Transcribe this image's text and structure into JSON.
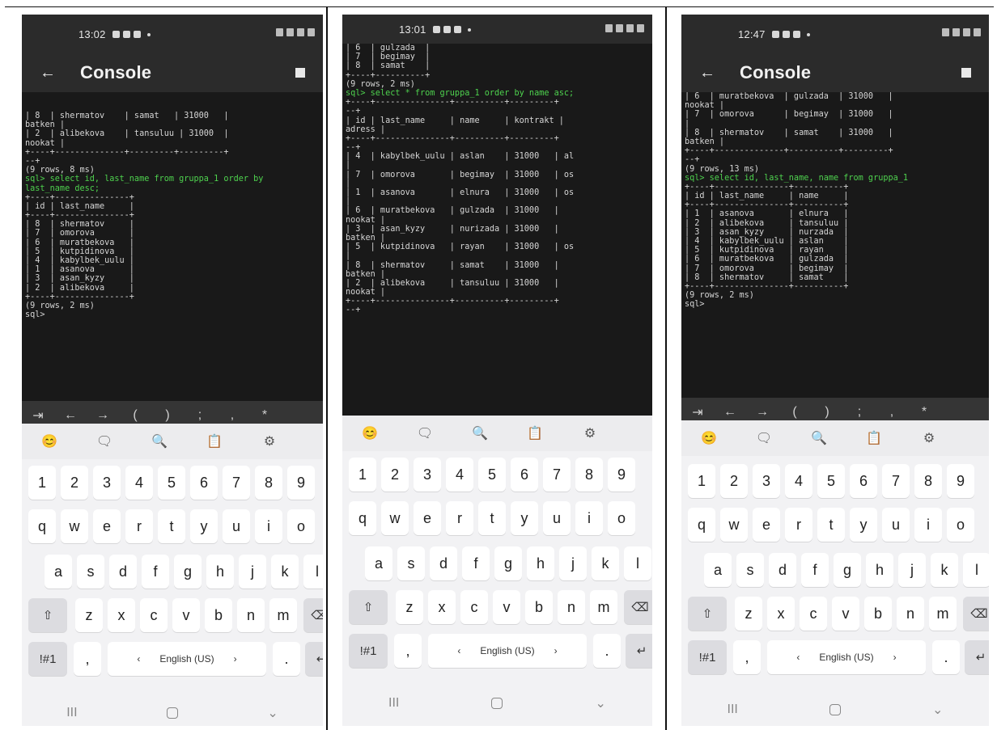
{
  "phones": [
    {
      "status_time": "13:02",
      "title": "Console",
      "console_lines": [
        "| 8  | shermatov    | samat   | 31000   |",
        "batken |",
        "| 2  | alibekova    | tansuluu | 31000  |",
        "nookat |",
        "+----+--------------+---------+---------+",
        "--+",
        "(9 rows, 8 ms)",
        "sql> select id, last_name from gruppa_1 order by",
        "last_name desc;",
        "+----+---------------+",
        "| id | last_name     |",
        "+----+---------------+",
        "| 8  | shermatov     |",
        "| 7  | omorova       |",
        "| 6  | muratbekova   |",
        "| 5  | kutpidinova   |",
        "| 4  | kabylbek_uulu |",
        "| 1  | asanova       |",
        "| 3  | asan_kyzy     |",
        "| 2  | alibekova     |",
        "+----+---------------+",
        "(9 rows, 2 ms)",
        "sql>"
      ],
      "sql_lines": [
        7,
        8
      ]
    },
    {
      "status_time": "13:01",
      "title": "",
      "console_lines": [
        "| 6  | gulzada  |",
        "| 7  | begimay  |",
        "| 8  | samat    |",
        "+----+----------+",
        "(9 rows, 2 ms)",
        "sql> select * from gruppa_1 order by name asc;",
        "+----+---------------+----------+---------+",
        "--+",
        "| id | last_name     | name     | kontrakt |",
        "adress |",
        "+----+---------------+----------+---------+",
        "--+",
        "| 4  | kabylbek_uulu | aslan    | 31000   | al",
        "|",
        "| 7  | omorova       | begimay  | 31000   | os",
        "|",
        "| 1  | asanova       | elnura   | 31000   | os",
        "|",
        "| 6  | muratbekova   | gulzada  | 31000   |",
        "nookat |",
        "| 3  | asan_kyzy     | nurizada | 31000   |",
        "batken |",
        "| 5  | kutpidinova   | rayan    | 31000   | os",
        "|",
        "| 8  | shermatov     | samat    | 31000   |",
        "batken |",
        "| 2  | alibekova     | tansuluu | 31000   |",
        "nookat |",
        "+----+---------------+----------+---------+",
        "--+"
      ],
      "sql_lines": [
        5
      ]
    },
    {
      "status_time": "12:47",
      "title": "Console",
      "console_lines": [
        "| 6  | muratbekova  | gulzada  | 31000   |",
        "nookat |",
        "| 7  | omorova      | begimay  | 31000   |",
        "|",
        "| 8  | shermatov    | samat    | 31000   |",
        "batken |",
        "+----+--------------+----------+---------+",
        "--+",
        "(9 rows, 13 ms)",
        "sql> select id, last_name, name from gruppa_1",
        "+----+---------------+----------+",
        "| id | last_name     | name     |",
        "+----+---------------+----------+",
        "| 1  | asanova       | elnura   |",
        "| 2  | alibekova     | tansuluu |",
        "| 3  | asan_kyzy     | nurzada  |",
        "| 4  | kabylbek_uulu | aslan    |",
        "| 5  | kutpidinova   | rayan    |",
        "| 6  | muratbekova   | gulzada  |",
        "| 7  | omorova       | begimay  |",
        "| 8  | shermatov     | samat    |",
        "+----+---------------+----------+",
        "(9 rows, 2 ms)",
        "sql>"
      ],
      "sql_lines": [
        9
      ]
    }
  ],
  "extra_keys": [
    "⇥",
    "←",
    "→",
    "(",
    ")",
    ";",
    ",",
    "*"
  ],
  "keyboard": {
    "numbers": [
      "1",
      "2",
      "3",
      "4",
      "5",
      "6",
      "7",
      "8",
      "9"
    ],
    "row1": [
      "q",
      "w",
      "e",
      "r",
      "t",
      "y",
      "u",
      "i",
      "o"
    ],
    "row2": [
      "a",
      "s",
      "d",
      "f",
      "g",
      "h",
      "j",
      "k",
      "l"
    ],
    "row3": [
      "z",
      "x",
      "c",
      "v",
      "b",
      "n",
      "m"
    ],
    "shift": "⇧",
    "symbols": "!#1",
    "comma": ",",
    "space_label": "English (US)",
    "period": ".",
    "enter": "↵",
    "space_left_arrow": "‹",
    "space_right_arrow": "›"
  },
  "suggestions": [
    "😊",
    "🗨",
    "🔍",
    "📋",
    "⚙"
  ],
  "nav": {
    "recents": "III",
    "back": "⌄"
  },
  "icons": {
    "back": "arrow-left",
    "stop": "stop-square",
    "home": "home-circle"
  },
  "colors": {
    "console_bg": "#191919",
    "sql_green": "#4ed24e",
    "statusbar": "#2b2b2b",
    "keyboard_bg": "#f2f2f4"
  }
}
